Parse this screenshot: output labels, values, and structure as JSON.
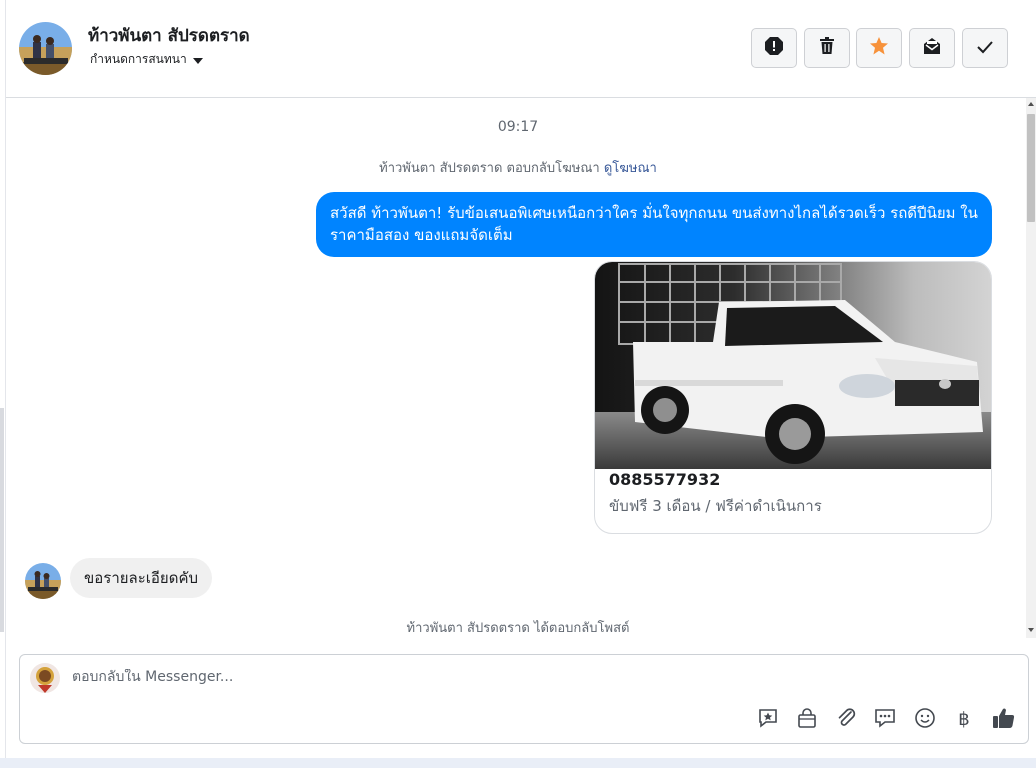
{
  "header": {
    "contact_name": "ท้าวพันตา สัปรดตราด",
    "assign_label": "กำหนดการสนทนา",
    "actions": [
      {
        "name": "report-button",
        "icon": "alert-icon"
      },
      {
        "name": "delete-button",
        "icon": "trash-icon"
      },
      {
        "name": "star-button",
        "icon": "star-icon"
      },
      {
        "name": "mark-unread-button",
        "icon": "envelope-icon"
      },
      {
        "name": "done-button",
        "icon": "check-icon"
      }
    ]
  },
  "conversation": {
    "timestamp": "09:17",
    "ad_reply_text": "ท้าวพันตา สัปรดตราด ตอบกลับโฆษณา",
    "ad_link": "ดูโฆษณา",
    "outgoing_message": "สวัสดี ท้าวพันตา! รับข้อเสนอพิเศษเหนือกว่าใคร  มั่นใจทุกถนน ขนส่งทางไกลได้รวดเร็ว รถดีปีนิยม ในราคามือสอง ของแถมจัดเต็ม",
    "ad_card": {
      "title": "0885577932",
      "subtitle": "ขับฟรี 3 เดือน / ฟรีค่าดำเนินการ"
    },
    "incoming_message": "ขอรายละเอียดคับ",
    "post_reply_text": "ท้าวพันตา สัปรดตราด ได้ตอบกลับโพสต์"
  },
  "composer": {
    "placeholder": "ตอบกลับใน Messenger...",
    "currency_symbol": "฿",
    "tools": [
      "saved-reply-icon",
      "shop-bag-icon",
      "attachment-icon",
      "quick-reply-icon",
      "emoji-icon",
      "baht-icon",
      "thumbs-up-icon"
    ]
  },
  "colors": {
    "accent": "#0084ff",
    "star": "#f7923b",
    "link": "#385898"
  }
}
